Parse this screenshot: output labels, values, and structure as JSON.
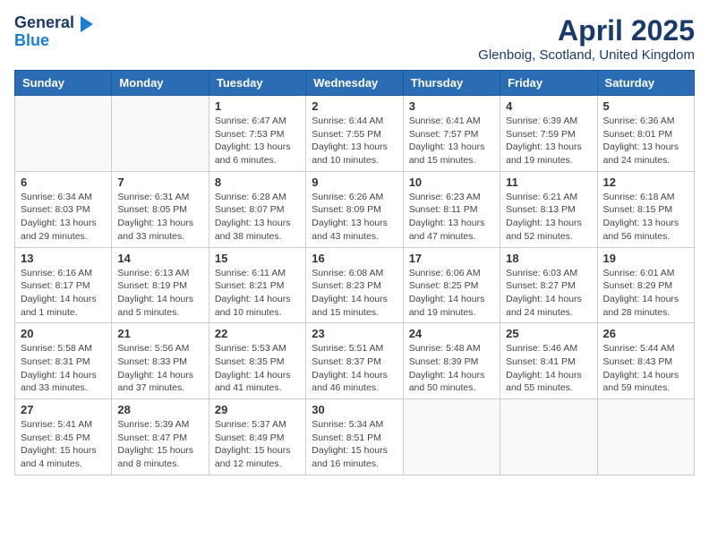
{
  "header": {
    "logo_general": "General",
    "logo_blue": "Blue",
    "month_title": "April 2025",
    "location": "Glenboig, Scotland, United Kingdom"
  },
  "weekdays": [
    "Sunday",
    "Monday",
    "Tuesday",
    "Wednesday",
    "Thursday",
    "Friday",
    "Saturday"
  ],
  "weeks": [
    [
      {
        "day": "",
        "info": ""
      },
      {
        "day": "",
        "info": ""
      },
      {
        "day": "1",
        "info": "Sunrise: 6:47 AM\nSunset: 7:53 PM\nDaylight: 13 hours and 6 minutes."
      },
      {
        "day": "2",
        "info": "Sunrise: 6:44 AM\nSunset: 7:55 PM\nDaylight: 13 hours and 10 minutes."
      },
      {
        "day": "3",
        "info": "Sunrise: 6:41 AM\nSunset: 7:57 PM\nDaylight: 13 hours and 15 minutes."
      },
      {
        "day": "4",
        "info": "Sunrise: 6:39 AM\nSunset: 7:59 PM\nDaylight: 13 hours and 19 minutes."
      },
      {
        "day": "5",
        "info": "Sunrise: 6:36 AM\nSunset: 8:01 PM\nDaylight: 13 hours and 24 minutes."
      }
    ],
    [
      {
        "day": "6",
        "info": "Sunrise: 6:34 AM\nSunset: 8:03 PM\nDaylight: 13 hours and 29 minutes."
      },
      {
        "day": "7",
        "info": "Sunrise: 6:31 AM\nSunset: 8:05 PM\nDaylight: 13 hours and 33 minutes."
      },
      {
        "day": "8",
        "info": "Sunrise: 6:28 AM\nSunset: 8:07 PM\nDaylight: 13 hours and 38 minutes."
      },
      {
        "day": "9",
        "info": "Sunrise: 6:26 AM\nSunset: 8:09 PM\nDaylight: 13 hours and 43 minutes."
      },
      {
        "day": "10",
        "info": "Sunrise: 6:23 AM\nSunset: 8:11 PM\nDaylight: 13 hours and 47 minutes."
      },
      {
        "day": "11",
        "info": "Sunrise: 6:21 AM\nSunset: 8:13 PM\nDaylight: 13 hours and 52 minutes."
      },
      {
        "day": "12",
        "info": "Sunrise: 6:18 AM\nSunset: 8:15 PM\nDaylight: 13 hours and 56 minutes."
      }
    ],
    [
      {
        "day": "13",
        "info": "Sunrise: 6:16 AM\nSunset: 8:17 PM\nDaylight: 14 hours and 1 minute."
      },
      {
        "day": "14",
        "info": "Sunrise: 6:13 AM\nSunset: 8:19 PM\nDaylight: 14 hours and 5 minutes."
      },
      {
        "day": "15",
        "info": "Sunrise: 6:11 AM\nSunset: 8:21 PM\nDaylight: 14 hours and 10 minutes."
      },
      {
        "day": "16",
        "info": "Sunrise: 6:08 AM\nSunset: 8:23 PM\nDaylight: 14 hours and 15 minutes."
      },
      {
        "day": "17",
        "info": "Sunrise: 6:06 AM\nSunset: 8:25 PM\nDaylight: 14 hours and 19 minutes."
      },
      {
        "day": "18",
        "info": "Sunrise: 6:03 AM\nSunset: 8:27 PM\nDaylight: 14 hours and 24 minutes."
      },
      {
        "day": "19",
        "info": "Sunrise: 6:01 AM\nSunset: 8:29 PM\nDaylight: 14 hours and 28 minutes."
      }
    ],
    [
      {
        "day": "20",
        "info": "Sunrise: 5:58 AM\nSunset: 8:31 PM\nDaylight: 14 hours and 33 minutes."
      },
      {
        "day": "21",
        "info": "Sunrise: 5:56 AM\nSunset: 8:33 PM\nDaylight: 14 hours and 37 minutes."
      },
      {
        "day": "22",
        "info": "Sunrise: 5:53 AM\nSunset: 8:35 PM\nDaylight: 14 hours and 41 minutes."
      },
      {
        "day": "23",
        "info": "Sunrise: 5:51 AM\nSunset: 8:37 PM\nDaylight: 14 hours and 46 minutes."
      },
      {
        "day": "24",
        "info": "Sunrise: 5:48 AM\nSunset: 8:39 PM\nDaylight: 14 hours and 50 minutes."
      },
      {
        "day": "25",
        "info": "Sunrise: 5:46 AM\nSunset: 8:41 PM\nDaylight: 14 hours and 55 minutes."
      },
      {
        "day": "26",
        "info": "Sunrise: 5:44 AM\nSunset: 8:43 PM\nDaylight: 14 hours and 59 minutes."
      }
    ],
    [
      {
        "day": "27",
        "info": "Sunrise: 5:41 AM\nSunset: 8:45 PM\nDaylight: 15 hours and 4 minutes."
      },
      {
        "day": "28",
        "info": "Sunrise: 5:39 AM\nSunset: 8:47 PM\nDaylight: 15 hours and 8 minutes."
      },
      {
        "day": "29",
        "info": "Sunrise: 5:37 AM\nSunset: 8:49 PM\nDaylight: 15 hours and 12 minutes."
      },
      {
        "day": "30",
        "info": "Sunrise: 5:34 AM\nSunset: 8:51 PM\nDaylight: 15 hours and 16 minutes."
      },
      {
        "day": "",
        "info": ""
      },
      {
        "day": "",
        "info": ""
      },
      {
        "day": "",
        "info": ""
      }
    ]
  ]
}
